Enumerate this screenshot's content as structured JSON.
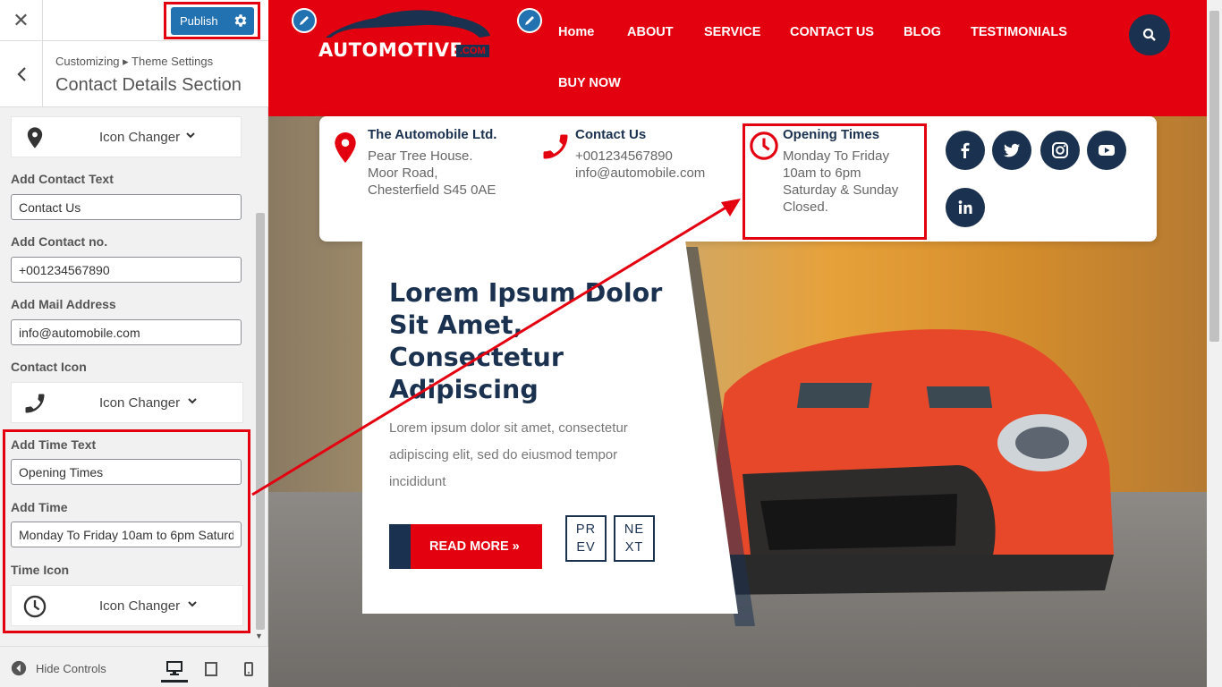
{
  "sidebar": {
    "close_glyph": "✕",
    "publish_label": "Publish",
    "breadcrumb": "Customizing ▸ Theme Settings",
    "section_title": "Contact Details Section",
    "icon_changer_label": "Icon Changer",
    "fields": {
      "contact_text": {
        "label": "Add Contact Text",
        "value": "Contact Us"
      },
      "contact_no": {
        "label": "Add Contact no.",
        "value": "+001234567890"
      },
      "mail": {
        "label": "Add Mail Address",
        "value": "info@automobile.com"
      },
      "contact_icon": {
        "label": "Contact Icon"
      },
      "time_text": {
        "label": "Add Time Text",
        "value": "Opening Times"
      },
      "time": {
        "label": "Add Time",
        "value": "Monday To Friday 10am to 6pm Saturd"
      },
      "time_icon": {
        "label": "Time Icon"
      }
    },
    "hide_controls": "Hide Controls"
  },
  "site": {
    "logo": {
      "text": "AUTOMOTIVE",
      "suffix": ".COM"
    },
    "nav": [
      "Home",
      "ABOUT",
      "SERVICE",
      "CONTACT US",
      "BLOG",
      "TESTIMONIALS",
      "BUY NOW"
    ],
    "address": {
      "title": "The Automobile Ltd.",
      "lines": [
        "Pear Tree House.",
        "Moor Road,",
        "Chesterfield S45 0AE"
      ]
    },
    "contact": {
      "title": "Contact Us",
      "phone": "+001234567890",
      "email": "info@automobile.com"
    },
    "hours": {
      "title": "Opening Times",
      "lines": [
        "Monday To Friday",
        "10am to 6pm",
        "Saturday & Sunday",
        "Closed."
      ]
    },
    "social": [
      "facebook-icon",
      "twitter-icon",
      "instagram-icon",
      "youtube-icon",
      "linkedin-icon"
    ],
    "slide": {
      "title": "Lorem Ipsum Dolor Sit Amet, Consectetur Adipiscing",
      "text": "Lorem ipsum dolor sit amet, consectetur adipiscing elit, sed do eiusmod tempor incididunt",
      "button": "READ MORE »",
      "prev": [
        "PR",
        "EV"
      ],
      "next": [
        "NE",
        "XT"
      ]
    }
  },
  "colors": {
    "brand_red": "#e3000f",
    "navy": "#1b3150",
    "wp_blue": "#2271b1",
    "annotation_red": "#e3000f"
  }
}
